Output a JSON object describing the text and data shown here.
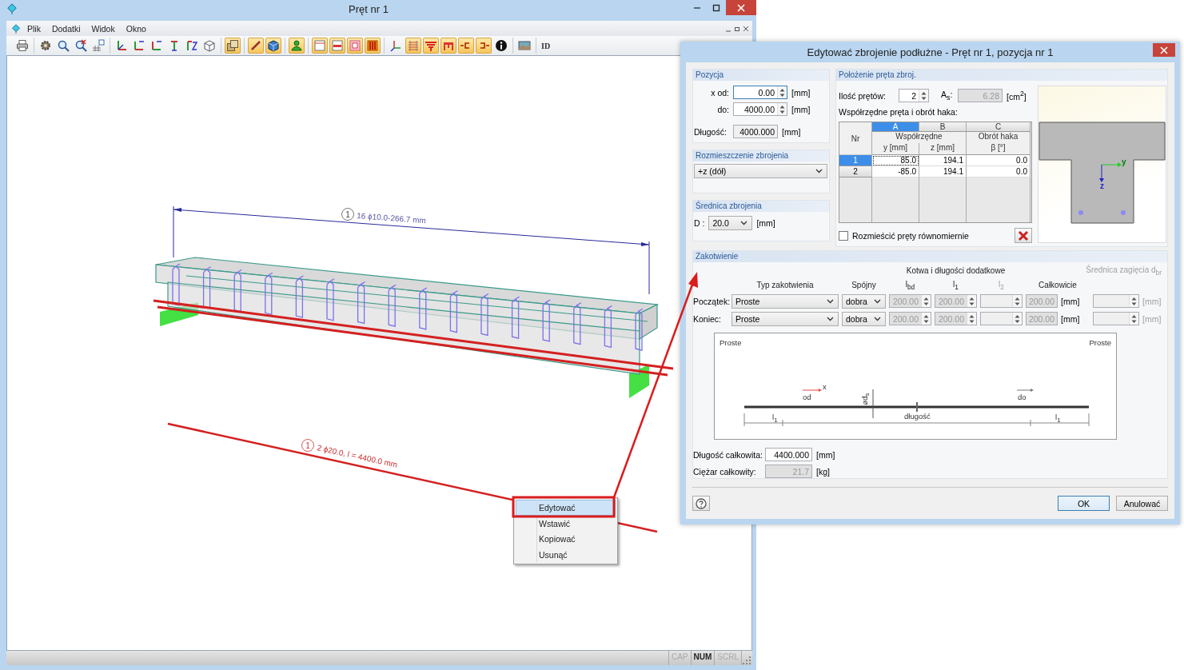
{
  "window": {
    "title": "Pręt nr 1"
  },
  "menu": [
    {
      "label": "Plik"
    },
    {
      "label": "Dodatki"
    },
    {
      "label": "Widok"
    },
    {
      "label": "Okno"
    }
  ],
  "toolbar": {
    "groups": [
      {
        "buttons": [
          {
            "pressed": false
          }
        ]
      },
      {
        "buttons": [
          {
            "pressed": false
          },
          {
            "pressed": false
          },
          {
            "pressed": false
          },
          {
            "pressed": false
          }
        ]
      },
      {
        "buttons": [
          {
            "pressed": false
          },
          {
            "pressed": false
          },
          {
            "pressed": false
          },
          {
            "pressed": false
          },
          {
            "pressed": false
          },
          {
            "pressed": false
          }
        ]
      },
      {
        "buttons": [
          {
            "pressed": true
          }
        ]
      },
      {
        "buttons": [
          {
            "pressed": true
          },
          {
            "pressed": true
          }
        ]
      },
      {
        "buttons": [
          {
            "pressed": true
          }
        ]
      },
      {
        "buttons": [
          {
            "pressed": true
          },
          {
            "pressed": true
          },
          {
            "pressed": true
          },
          {
            "pressed": true
          }
        ]
      },
      {
        "buttons": [
          {
            "pressed": false
          },
          {
            "pressed": true
          },
          {
            "pressed": true
          },
          {
            "pressed": true
          },
          {
            "pressed": true
          },
          {
            "pressed": true
          },
          {
            "pressed": false
          }
        ]
      },
      {
        "buttons": [
          {
            "pressed": false
          }
        ]
      }
    ],
    "id_button": "ID"
  },
  "view": {
    "stirrup_label": {
      "number": "1",
      "text": "16 ϕ10.0-266.7 mm"
    },
    "bar_label": {
      "number": "1",
      "text": "2 ϕ20.0, l = 4400.0 mm"
    }
  },
  "context_menu": [
    {
      "label": "Edytować",
      "selected": true
    },
    {
      "label": "Wstawić",
      "selected": false
    },
    {
      "label": "Kopiować",
      "selected": false
    },
    {
      "label": "Usunąć",
      "selected": false
    }
  ],
  "status_bar": [
    {
      "label": "CAP",
      "on": false
    },
    {
      "label": "NUM",
      "on": true
    },
    {
      "label": "SCRL",
      "on": false
    }
  ],
  "dialog": {
    "title": "Edytować zbrojenie podłużne - Pręt nr 1, pozycja nr 1",
    "position": {
      "title": "Pozycja",
      "x_from": {
        "label": "x od:",
        "value": "0.00",
        "unit": "[mm]",
        "focused": true
      },
      "x_to": {
        "label": "do:",
        "value": "4000.00",
        "unit": "[mm]",
        "focused": false
      },
      "length": {
        "label": "Długość:",
        "value": "4000.000",
        "unit": "[mm]"
      }
    },
    "distribution": {
      "title": "Rozmieszczenie zbrojenia",
      "value": "+z (dół)"
    },
    "diameter": {
      "title": "Średnica zbrojenia",
      "label": "D :",
      "value": "20.0",
      "unit": "[mm]"
    },
    "placement": {
      "title": "Położenie pręta zbroj.",
      "count": {
        "label": "Ilość prętów:",
        "value": "2"
      },
      "area": {
        "label": "A$_{s}$:",
        "value": "6.28",
        "unit": "[cm$^{2}$]",
        "disabled": true
      },
      "table_title": "Współrzędne pręta i obrót haka:",
      "table": {
        "nr_header": "Nr",
        "columns": [
          {
            "letter": "A",
            "selected": true
          },
          {
            "letter": "B",
            "selected": false
          },
          {
            "letter": "C",
            "selected": false
          }
        ],
        "groups": [
          "Współrzędne",
          "Obrót haka"
        ],
        "units": [
          "y [mm]",
          "z [mm]",
          "β [°]"
        ],
        "rows": [
          {
            "nr": "1",
            "selected": true,
            "cells": [
              "85.0",
              "194.1",
              "0.0"
            ]
          },
          {
            "nr": "2",
            "selected": false,
            "cells": [
              "-85.0",
              "194.1",
              "0.0"
            ]
          }
        ]
      },
      "distribute_evenly": {
        "label": "Rozmieścić pręty równomiernie",
        "checked": false
      }
    },
    "preview": {
      "y_label": "y",
      "z_label": "z"
    },
    "anchorage": {
      "title": "Zakotwienie",
      "group_header": "Kotwa i długości dodatkowe",
      "bend_header": {
        "label": "Średnica zagięcia d$_{br}$",
        "disabled": true
      },
      "columns": [
        {
          "label": "Typ zakotwienia",
          "disabled": false
        },
        {
          "label": "Spójny",
          "disabled": false
        },
        {
          "label": "l$_{bd}$",
          "disabled": false
        },
        {
          "label": "l$_{1}$",
          "disabled": false
        },
        {
          "label": "l$_{2}$",
          "disabled": true
        },
        {
          "label": "Całkowicie",
          "disabled": false
        }
      ],
      "rows": [
        {
          "label": "Początek:",
          "type": "Proste",
          "bond": "dobra",
          "lbd": "200.00",
          "l1": "200.00",
          "total": "200.00",
          "fields_disabled": true,
          "total_unit": "[mm]",
          "bend_unit": "[mm]"
        },
        {
          "label": "Koniec:",
          "type": "Proste",
          "bond": "dobra",
          "lbd": "200.00",
          "l1": "200.00",
          "total": "200.00",
          "fields_disabled": true,
          "total_unit": "[mm]",
          "bend_unit": "[mm]"
        }
      ]
    },
    "diagram": {
      "start_type": "Proste",
      "end_type": "Proste",
      "x_axis": "x",
      "from": "od",
      "to": "do",
      "bar_diameter": "ød$_{s}$",
      "length": "długość",
      "l1_start": "l$_{1}$",
      "l1_end": "l$_{1}$"
    },
    "total_length": {
      "label": "Długość całkowita:",
      "value": "4400.000",
      "unit": "[mm]",
      "disabled": false
    },
    "total_weight": {
      "label": "Ciężar całkowity:",
      "value": "21.7",
      "unit": "[kg]",
      "disabled": true
    },
    "buttons": [
      {
        "label": "OK",
        "default": true
      },
      {
        "label": "Anulować",
        "default": false
      }
    ]
  }
}
